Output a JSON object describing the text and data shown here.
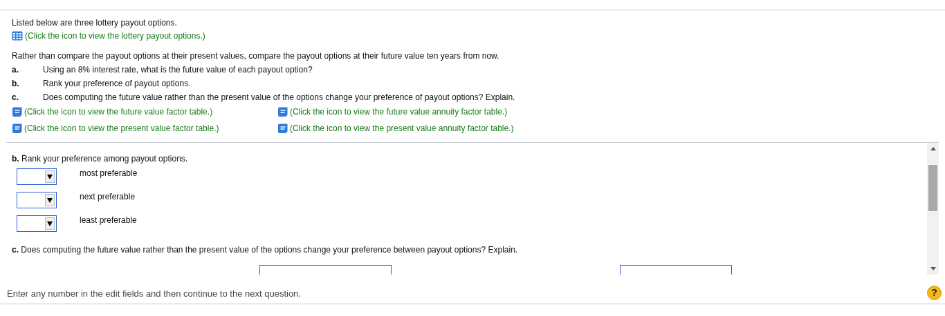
{
  "intro": "Listed below are three lottery payout options.",
  "payout_link": "(Click the icon to view the lottery payout options.)",
  "question": "Rather than compare the payout options at their present values, compare the payout options at their future value ten years from now.",
  "parts": [
    {
      "letter": "a.",
      "text": "Using an 8% interest rate, what is the future value of each payout option?"
    },
    {
      "letter": "b.",
      "text": "Rank your preference of payout options."
    },
    {
      "letter": "c.",
      "text": "Does computing the future value rather than the present value of the options change your preference of payout options? Explain."
    }
  ],
  "table_links": [
    "(Click the icon to view the future value factor table.)",
    "(Click the icon to view the future value annuity factor table.)",
    "(Click the icon to view the present value factor table.)",
    "(Click the icon to view the present value annuity factor table.)"
  ],
  "section_b": {
    "heading": "**b.** Rank your preference among payout options.",
    "rows": [
      {
        "label": "most preferable"
      },
      {
        "label": "next preferable"
      },
      {
        "label": "least preferable"
      }
    ]
  },
  "section_c": {
    "heading": "**c.** Does computing the future value rather than the present value of the options change your preference between payout options? Explain."
  },
  "footer": "Enter any number in the edit fields and then continue to the next question.",
  "help_button": "?"
}
